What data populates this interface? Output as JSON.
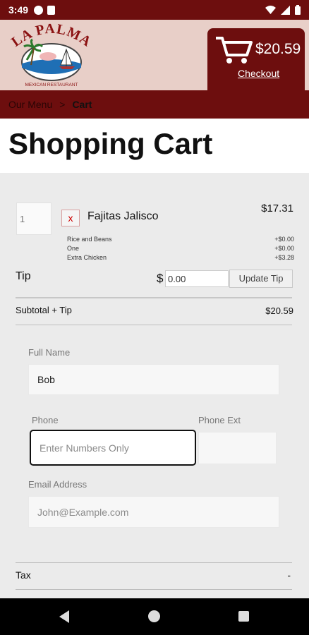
{
  "status_bar": {
    "time": "3:49"
  },
  "header": {
    "logo_text": "LA PALMA",
    "logo_subtext": "MEXICAN RESTAURANT",
    "cart_total": "$20.59",
    "checkout_label": "Checkout"
  },
  "breadcrumb": {
    "menu_link": "Our Menu",
    "separator": ">",
    "current": "Cart"
  },
  "page_title": "Shopping Cart",
  "cart_item": {
    "quantity": "1",
    "remove_label": "x",
    "name": "Fajitas Jalisco",
    "price": "$17.31",
    "modifiers": [
      {
        "name": "Rice and Beans",
        "price": "+$0.00"
      },
      {
        "name": "One",
        "price": "+$0.00"
      },
      {
        "name": "Extra Chicken",
        "price": "+$3.28"
      }
    ]
  },
  "tip": {
    "label": "Tip",
    "currency_symbol": "$",
    "value": "0.00",
    "update_button": "Update Tip"
  },
  "subtotal": {
    "label": "Subtotal + Tip",
    "value": "$20.59"
  },
  "form": {
    "full_name": {
      "label": "Full Name",
      "value": "Bob"
    },
    "phone": {
      "label": "Phone",
      "placeholder": "Enter Numbers Only"
    },
    "phone_ext": {
      "label": "Phone Ext",
      "value": ""
    },
    "email": {
      "label": "Email Address",
      "placeholder": "John@Example.com"
    }
  },
  "tax": {
    "label": "Tax",
    "value": "-"
  },
  "colors": {
    "brand": "#6d0e0e",
    "header_bg": "#e8cfc8",
    "content_bg": "#ebebeb"
  }
}
